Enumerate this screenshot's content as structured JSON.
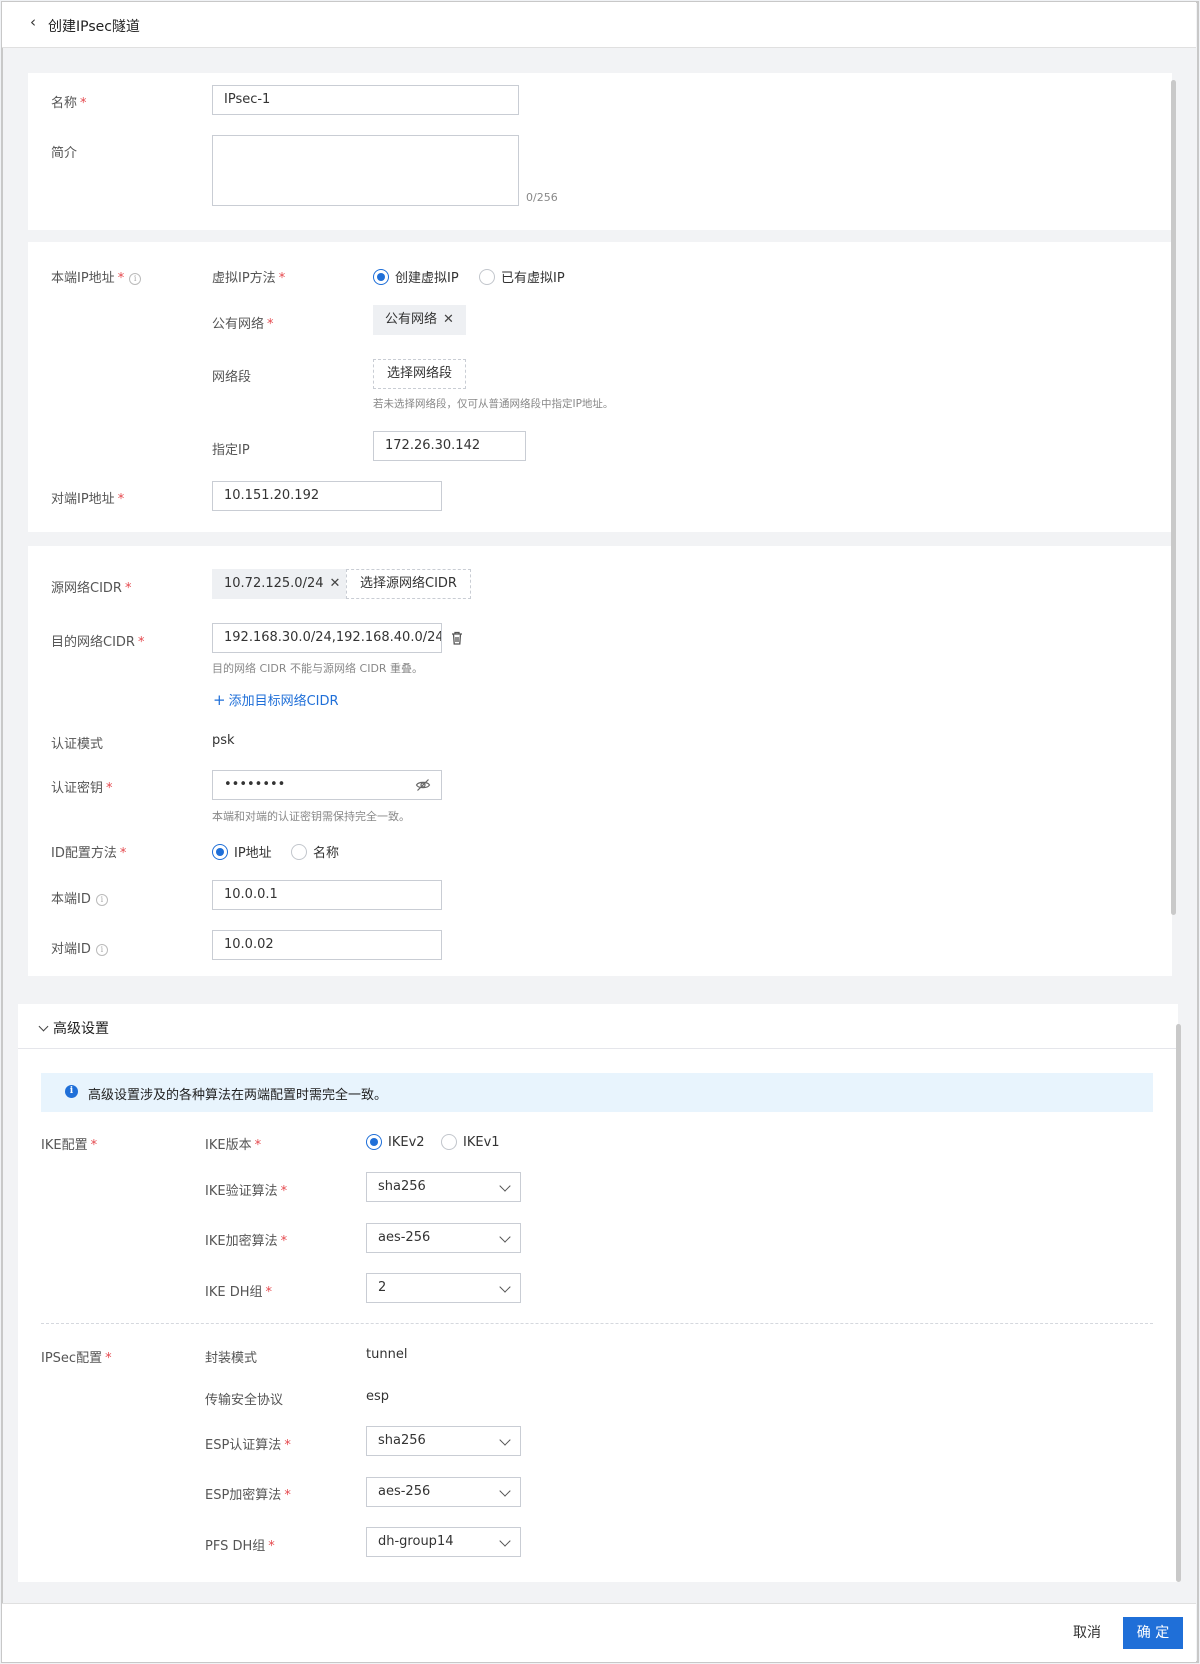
{
  "header": {
    "back_glyph": "‹",
    "title": "创建IPsec隧道"
  },
  "basic": {
    "name_label": "名称",
    "name_value": "IPsec-1",
    "desc_label": "简介",
    "desc_counter": "0/256"
  },
  "local": {
    "local_ip_label": "本端IP地址",
    "vip_method_label": "虚拟IP方法",
    "vip_option_create": "创建虚拟IP",
    "vip_option_existing": "已有虚拟IP",
    "public_net_label": "公有网络",
    "public_net_tag": "公有网络",
    "segment_label": "网络段",
    "segment_button": "选择网络段",
    "segment_hint": "若未选择网络段，仅可从普通网络段中指定IP地址。",
    "assigned_ip_label": "指定IP",
    "assigned_ip_value": "172.26.30.142",
    "peer_ip_label": "对端IP地址",
    "peer_ip_value": "10.151.20.192"
  },
  "network": {
    "src_cidr_label": "源网络CIDR",
    "src_cidr_tag": "10.72.125.0/24",
    "src_cidr_button": "选择源网络CIDR",
    "dst_cidr_label": "目的网络CIDR",
    "dst_cidr_value": "192.168.30.0/24,192.168.40.0/24",
    "dst_cidr_hint": "目的网络 CIDR 不能与源网络 CIDR 重叠。",
    "add_dst_link": "添加目标网络CIDR",
    "auth_mode_label": "认证模式",
    "auth_mode_value": "psk",
    "auth_key_label": "认证密钥",
    "auth_key_value": "••••••••",
    "auth_key_hint": "本端和对端的认证密钥需保持完全一致。",
    "id_method_label": "ID配置方法",
    "id_option_ip": "IP地址",
    "id_option_name": "名称",
    "local_id_label": "本端ID",
    "local_id_value": "10.0.0.1",
    "peer_id_label": "对端ID",
    "peer_id_value": "10.0.02"
  },
  "advanced": {
    "title": "高级设置",
    "notice": "高级设置涉及的各种算法在两端配置时需完全一致。",
    "ike_group_label": "IKE配置",
    "ike_version_label": "IKE版本",
    "ike_v2": "IKEv2",
    "ike_v1": "IKEv1",
    "ike_auth_label": "IKE验证算法",
    "ike_auth_value": "sha256",
    "ike_enc_label": "IKE加密算法",
    "ike_enc_value": "aes-256",
    "ike_dh_label": "IKE DH组",
    "ike_dh_value": "2",
    "ipsec_group_label": "IPSec配置",
    "encap_label": "封装模式",
    "encap_value": "tunnel",
    "proto_label": "传输安全协议",
    "proto_value": "esp",
    "esp_auth_label": "ESP认证算法",
    "esp_auth_value": "sha256",
    "esp_enc_label": "ESP加密算法",
    "esp_enc_value": "aes-256",
    "pfs_label": "PFS DH组",
    "pfs_value": "dh-group14"
  },
  "footer": {
    "cancel": "取消",
    "confirm": "确 定"
  },
  "colors": {
    "primary": "#1f6fd8",
    "required": "#e5484d",
    "notice_bg": "#e8f4fd"
  },
  "icons": [
    "chevron-left-icon",
    "info-icon",
    "close-icon",
    "trash-icon",
    "eye-off-icon",
    "plus-icon",
    "chevron-down-icon"
  ]
}
